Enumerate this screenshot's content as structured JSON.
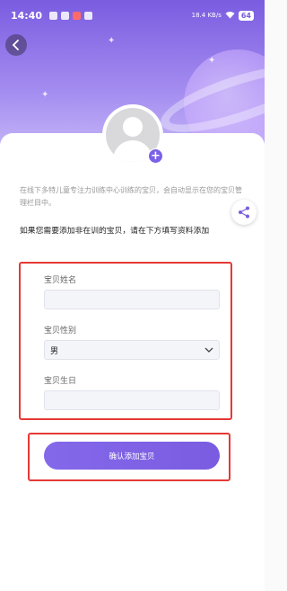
{
  "status_bar": {
    "time": "14:40",
    "network_speed": "18.4 KB/s",
    "battery": "64"
  },
  "header": {
    "back_icon": "chevron-left-icon"
  },
  "intro_text": "在线下多特儿童专注力训练中心训练的宝贝，会自动显示在您的宝贝管理栏目中。",
  "notice_text": "如果您需要添加非在训的宝贝，请在下方填写资料添加",
  "form": {
    "name_label": "宝贝姓名",
    "name_value": "",
    "gender_label": "宝贝性别",
    "gender_value": "男",
    "birthday_label": "宝贝生日",
    "birthday_value": ""
  },
  "confirm_button": "确认添加宝贝",
  "colors": {
    "accent": "#7a5ce0",
    "highlight": "#e53935"
  }
}
